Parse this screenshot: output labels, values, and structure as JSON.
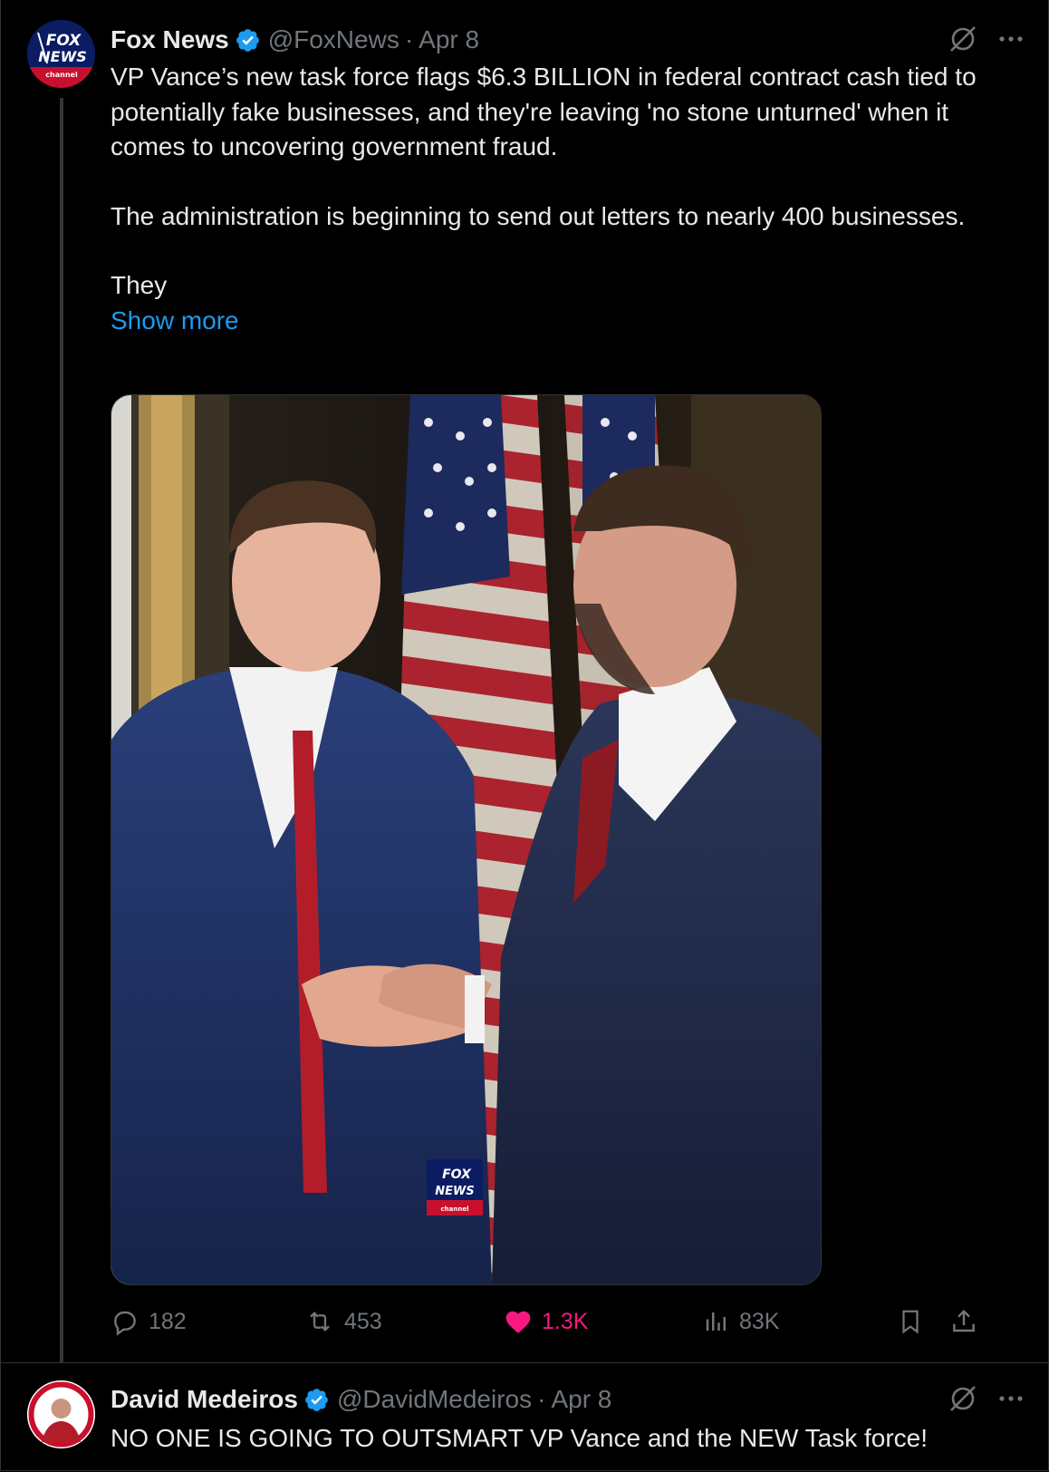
{
  "tweet": {
    "author_name": "Fox News",
    "author_handle": "@FoxNews",
    "separator": "·",
    "time": "Apr 8",
    "text_p1": "VP Vance’s new task force flags $6.3 BILLION in federal contract cash tied to potentially fake businesses, and they're leaving 'no stone unturned' when it comes to uncovering government fraud.",
    "text_p2": "The administration is beginning to send out letters to nearly 400 businesses.",
    "text_p3": "They",
    "show_more": "Show more",
    "media_watermark": "FOX NEWS channel",
    "stats": {
      "replies": "182",
      "reposts": "453",
      "likes": "1.3K",
      "views": "83K"
    },
    "liked": true,
    "like_color": "#f91880",
    "verified_color": "#1d9bf0",
    "avatar_logo": "FOX NEWS channel"
  },
  "reply": {
    "author_name": "David Medeiros",
    "author_handle": "@DavidMedeiros",
    "separator": "·",
    "time": "Apr 8",
    "text": "NO ONE IS GOING TO OUTSMART VP Vance and the NEW Task force!"
  },
  "icons": {
    "grok": "grok-icon",
    "more": "more-icon",
    "reply": "reply-icon",
    "repost": "repost-icon",
    "like": "heart-icon",
    "views": "views-icon",
    "bookmark": "bookmark-icon",
    "share": "share-icon",
    "verified": "verified-badge-icon"
  }
}
